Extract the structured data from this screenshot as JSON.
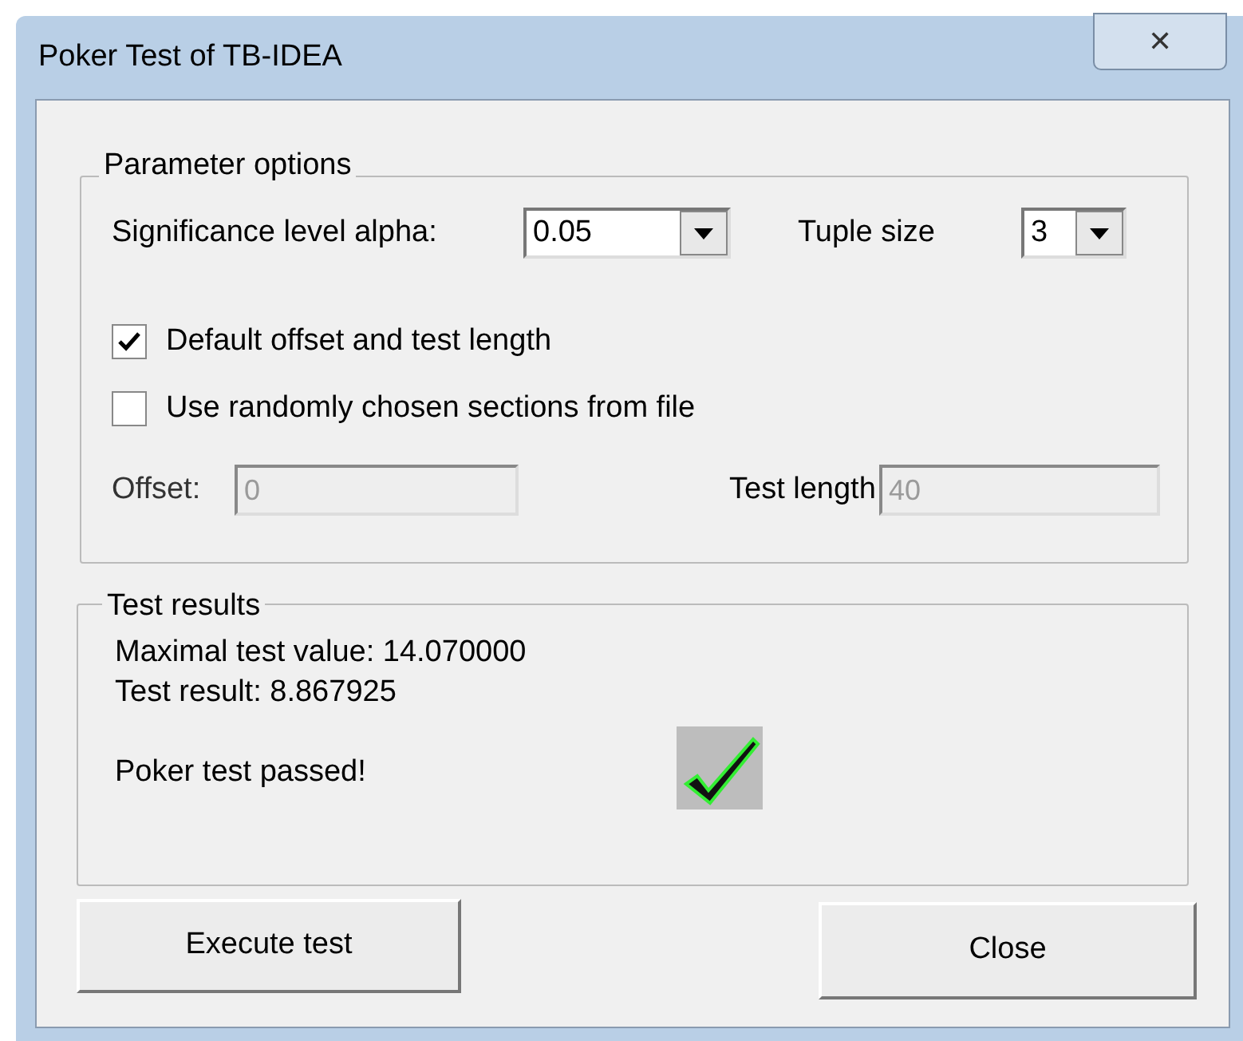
{
  "window": {
    "title": "Poker Test of TB-IDEA",
    "close": "✕"
  },
  "parameters": {
    "legend": "Parameter options",
    "alpha": {
      "label": "Significance level alpha:",
      "value": "0.05"
    },
    "tuple": {
      "label": "Tuple size",
      "value": "3"
    },
    "checkboxes": [
      {
        "label": "Default offset and test length",
        "checked": true
      },
      {
        "label": "Use randomly chosen sections from file",
        "checked": false
      }
    ],
    "offset": {
      "label": "Offset:",
      "value": "0",
      "disabled": true
    },
    "length": {
      "label": "Test length",
      "value": "40",
      "disabled": true
    }
  },
  "results": {
    "legend": "Test results",
    "max_value": "Maximal test value: 14.070000",
    "result": "Test result: 8.867925",
    "verdict": "Poker test passed!",
    "passed": true
  },
  "buttons": [
    {
      "label": "Execute test"
    },
    {
      "label": "Close"
    }
  ]
}
